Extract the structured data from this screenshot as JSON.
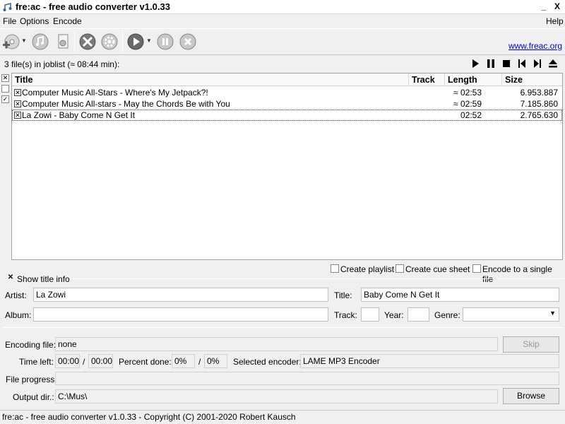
{
  "window": {
    "title": "fre:ac - free audio converter v1.0.33",
    "minimize": "_",
    "close": "X"
  },
  "menu": {
    "file": "File",
    "options": "Options",
    "encode": "Encode",
    "help": "Help"
  },
  "toolbar": {
    "website_link": "www.freac.org"
  },
  "joblist": {
    "info": "3 file(s) in joblist (≈ 08:44 min):",
    "columns": {
      "title": "Title",
      "track": "Track",
      "length": "Length",
      "size": "Size"
    },
    "rows": [
      {
        "checked": "✕",
        "title": "Computer Music All-Stars - Where's My Jetpack?!",
        "track": "",
        "length": "≈ 02:53",
        "size": "6.953.887"
      },
      {
        "checked": "✕",
        "title": "Computer Music All-stars - May the Chords Be with You",
        "track": "",
        "length": "≈ 02:59",
        "size": "7.185.860"
      },
      {
        "checked": "✕",
        "title": "La Zowi - Baby Come N Get It",
        "track": "",
        "length": "02:52",
        "size": "2.765.630"
      }
    ],
    "side_checks": [
      "✕",
      "",
      "✓"
    ]
  },
  "options": {
    "create_playlist": "Create playlist",
    "create_cue_sheet": "Create cue sheet",
    "encode_single_file": "Encode to a single file"
  },
  "title_info": {
    "toggle_label": "Show title info",
    "toggle_mark": "✕",
    "artist_label": "Artist:",
    "artist_value": "La Zowi",
    "title_label": "Title:",
    "title_value": "Baby Come N Get It",
    "album_label": "Album:",
    "album_value": "",
    "track_label": "Track:",
    "track_value": "",
    "year_label": "Year:",
    "year_value": "",
    "genre_label": "Genre:",
    "genre_value": ""
  },
  "encoding": {
    "file_label": "Encoding file:",
    "file_value": "none",
    "skip_button": "Skip",
    "time_left_label": "Time left:",
    "time_left_value": "00:00",
    "time_slash": "/",
    "time_total_value": "00:00",
    "percent_label": "Percent done:",
    "percent_value": "0%",
    "percent_slash": "/",
    "percent_total_value": "0%",
    "encoder_label": "Selected encoder:",
    "encoder_value": "LAME MP3 Encoder",
    "file_progress_label": "File progress:",
    "file_progress": 0,
    "output_label": "Output dir.:",
    "output_value": "C:\\Mus\\",
    "browse_button": "Browse"
  },
  "status": {
    "text": "fre:ac - free audio converter v1.0.33 - Copyright (C) 2001-2020 Robert Kausch"
  }
}
